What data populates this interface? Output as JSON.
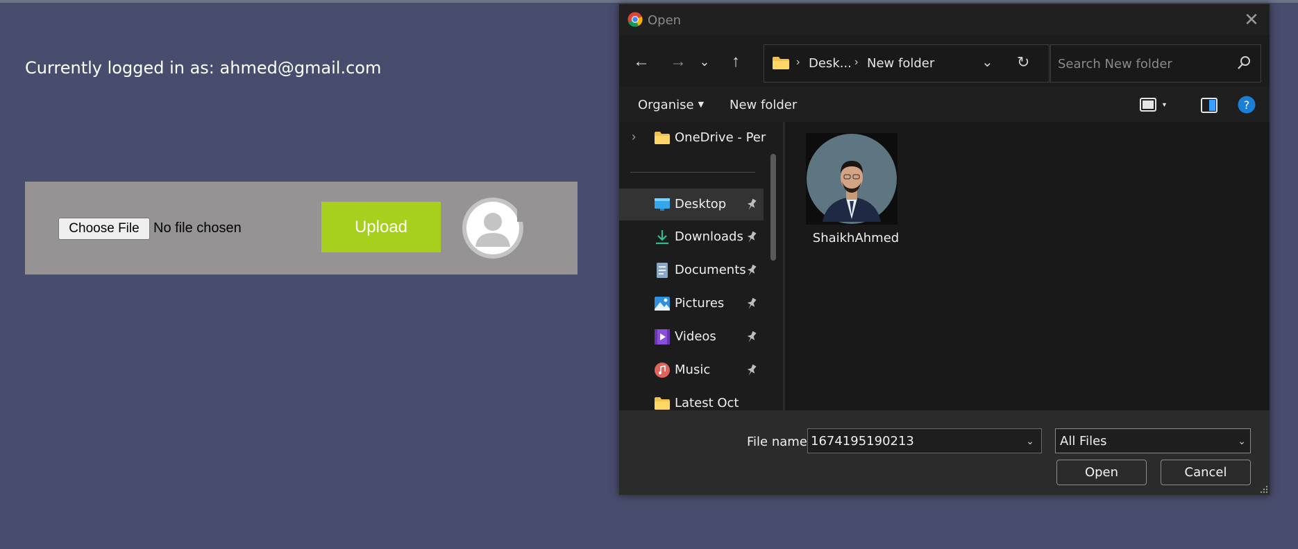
{
  "page": {
    "logged_in_text": "Currently logged in as: ahmed@gmail.com",
    "choose_file_label": "Choose File",
    "no_file_text": "No file chosen",
    "upload_label": "Upload"
  },
  "dialog": {
    "title": "Open",
    "close_glyph": "✕",
    "nav": {
      "back": "←",
      "forward": "→",
      "recent": "⌄",
      "up": "↑",
      "refresh": "↻"
    },
    "address": {
      "crumb_1": "Desk...",
      "crumb_2": "New folder",
      "sep": "›",
      "dropdown": "⌄"
    },
    "search_placeholder": "Search New folder",
    "commands": {
      "organise": "Organise",
      "new_folder": "New folder"
    },
    "nav_pane": {
      "onedrive": "OneDrive - Perso",
      "items": [
        {
          "label": "Desktop",
          "icon": "desktop-icon"
        },
        {
          "label": "Downloads",
          "icon": "downloads-icon"
        },
        {
          "label": "Documents",
          "icon": "documents-icon"
        },
        {
          "label": "Pictures",
          "icon": "pictures-icon"
        },
        {
          "label": "Videos",
          "icon": "videos-icon"
        },
        {
          "label": "Music",
          "icon": "music-icon"
        },
        {
          "label": "Latest Oct",
          "icon": "folder-icon"
        }
      ]
    },
    "files": [
      {
        "name": "ShaikhAhmed"
      }
    ],
    "footer": {
      "file_name_label": "File name:",
      "file_name_value": "1674195190213",
      "file_type": "All Files",
      "open_label": "Open",
      "cancel_label": "Cancel"
    }
  },
  "colors": {
    "page_bg": "#494d6d",
    "upload_green": "#a7cf1d",
    "panel_gray": "#959393",
    "dialog_bg": "#202020",
    "help_blue": "#1a7fd6"
  }
}
